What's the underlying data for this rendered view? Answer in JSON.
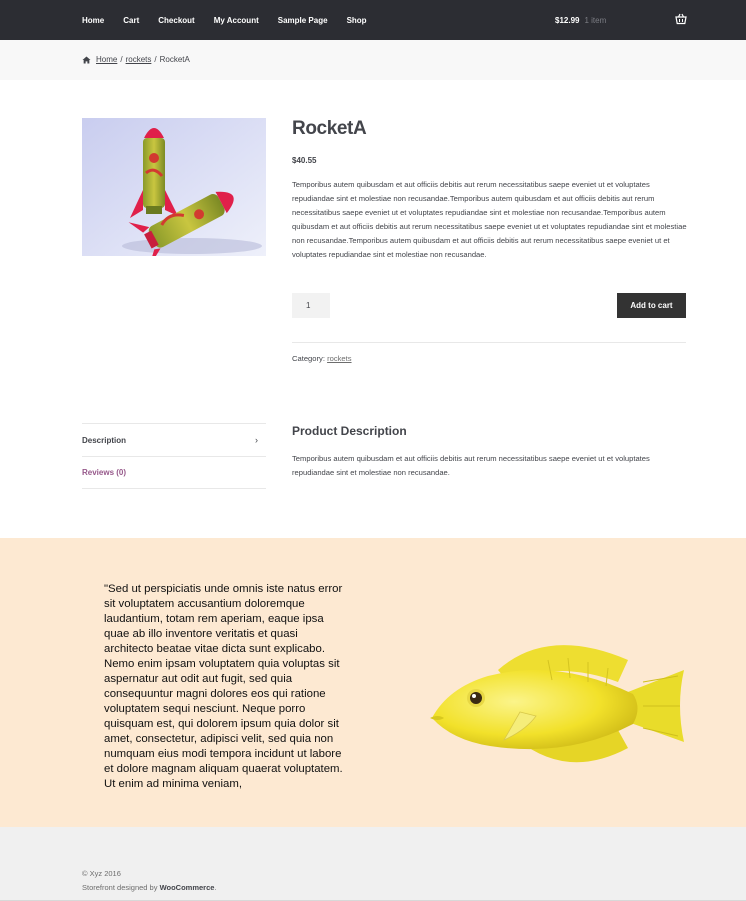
{
  "nav": {
    "items": [
      "Home",
      "Cart",
      "Checkout",
      "My Account",
      "Sample Page",
      "Shop"
    ]
  },
  "cart": {
    "amount": "$12.99",
    "count": "1 item",
    "icon": "basket-icon"
  },
  "breadcrumb": {
    "home": "Home",
    "category": "rockets",
    "separator": "/",
    "current": "RocketA"
  },
  "product": {
    "title": "RocketA",
    "price": "$40.55",
    "short_description": "Temporibus autem quibusdam et aut officiis debitis aut rerum necessitatibus saepe eveniet ut et voluptates repudiandae sint et molestiae non recusandae.Temporibus autem quibusdam et aut officiis debitis aut rerum necessitatibus saepe eveniet ut et voluptates repudiandae sint et molestiae non recusandae.Temporibus autem quibusdam et aut officiis debitis aut rerum necessitatibus saepe eveniet ut et voluptates repudiandae sint et molestiae non recusandae.Temporibus autem quibusdam et aut officiis debitis aut rerum necessitatibus saepe eveniet ut et voluptates repudiandae sint et molestiae non recusandae.",
    "quantity": "1",
    "add_to_cart": "Add to cart",
    "category_label": "Category:",
    "category": "rockets"
  },
  "tabs": {
    "description": "Description",
    "reviews": "Reviews (0)",
    "chevron": "›"
  },
  "description": {
    "heading": "Product Description",
    "text": "Temporibus autem quibusdam et aut officiis debitis aut rerum necessitatibus saepe eveniet ut et voluptates repudiandae sint et molestiae non recusandae."
  },
  "promo": {
    "quote": "\"Sed ut perspiciatis unde omnis iste natus error sit voluptatem accusantium doloremque laudantium, totam rem aperiam, eaque ipsa quae ab illo inventore veritatis et quasi architecto beatae vitae dicta sunt explicabo. Nemo enim ipsam voluptatem quia voluptas sit aspernatur aut odit aut fugit, sed quia consequuntur magni dolores eos qui ratione voluptatem sequi nesciunt. Neque porro quisquam est, qui dolorem ipsum quia dolor sit amet, consectetur, adipisci velit, sed quia non numquam eius modi tempora incidunt ut labore et dolore magnam aliquam quaerat voluptatem. Ut enim ad minima veniam,",
    "background": "#fde9d2"
  },
  "footer": {
    "copyright": "© Xyz 2016",
    "credit_prefix": "Storefront designed by ",
    "credit_link": "WooCommerce",
    "credit_suffix": "."
  },
  "colors": {
    "topbar": "#2c2d33",
    "accent": "#96588a",
    "button": "#333333"
  }
}
